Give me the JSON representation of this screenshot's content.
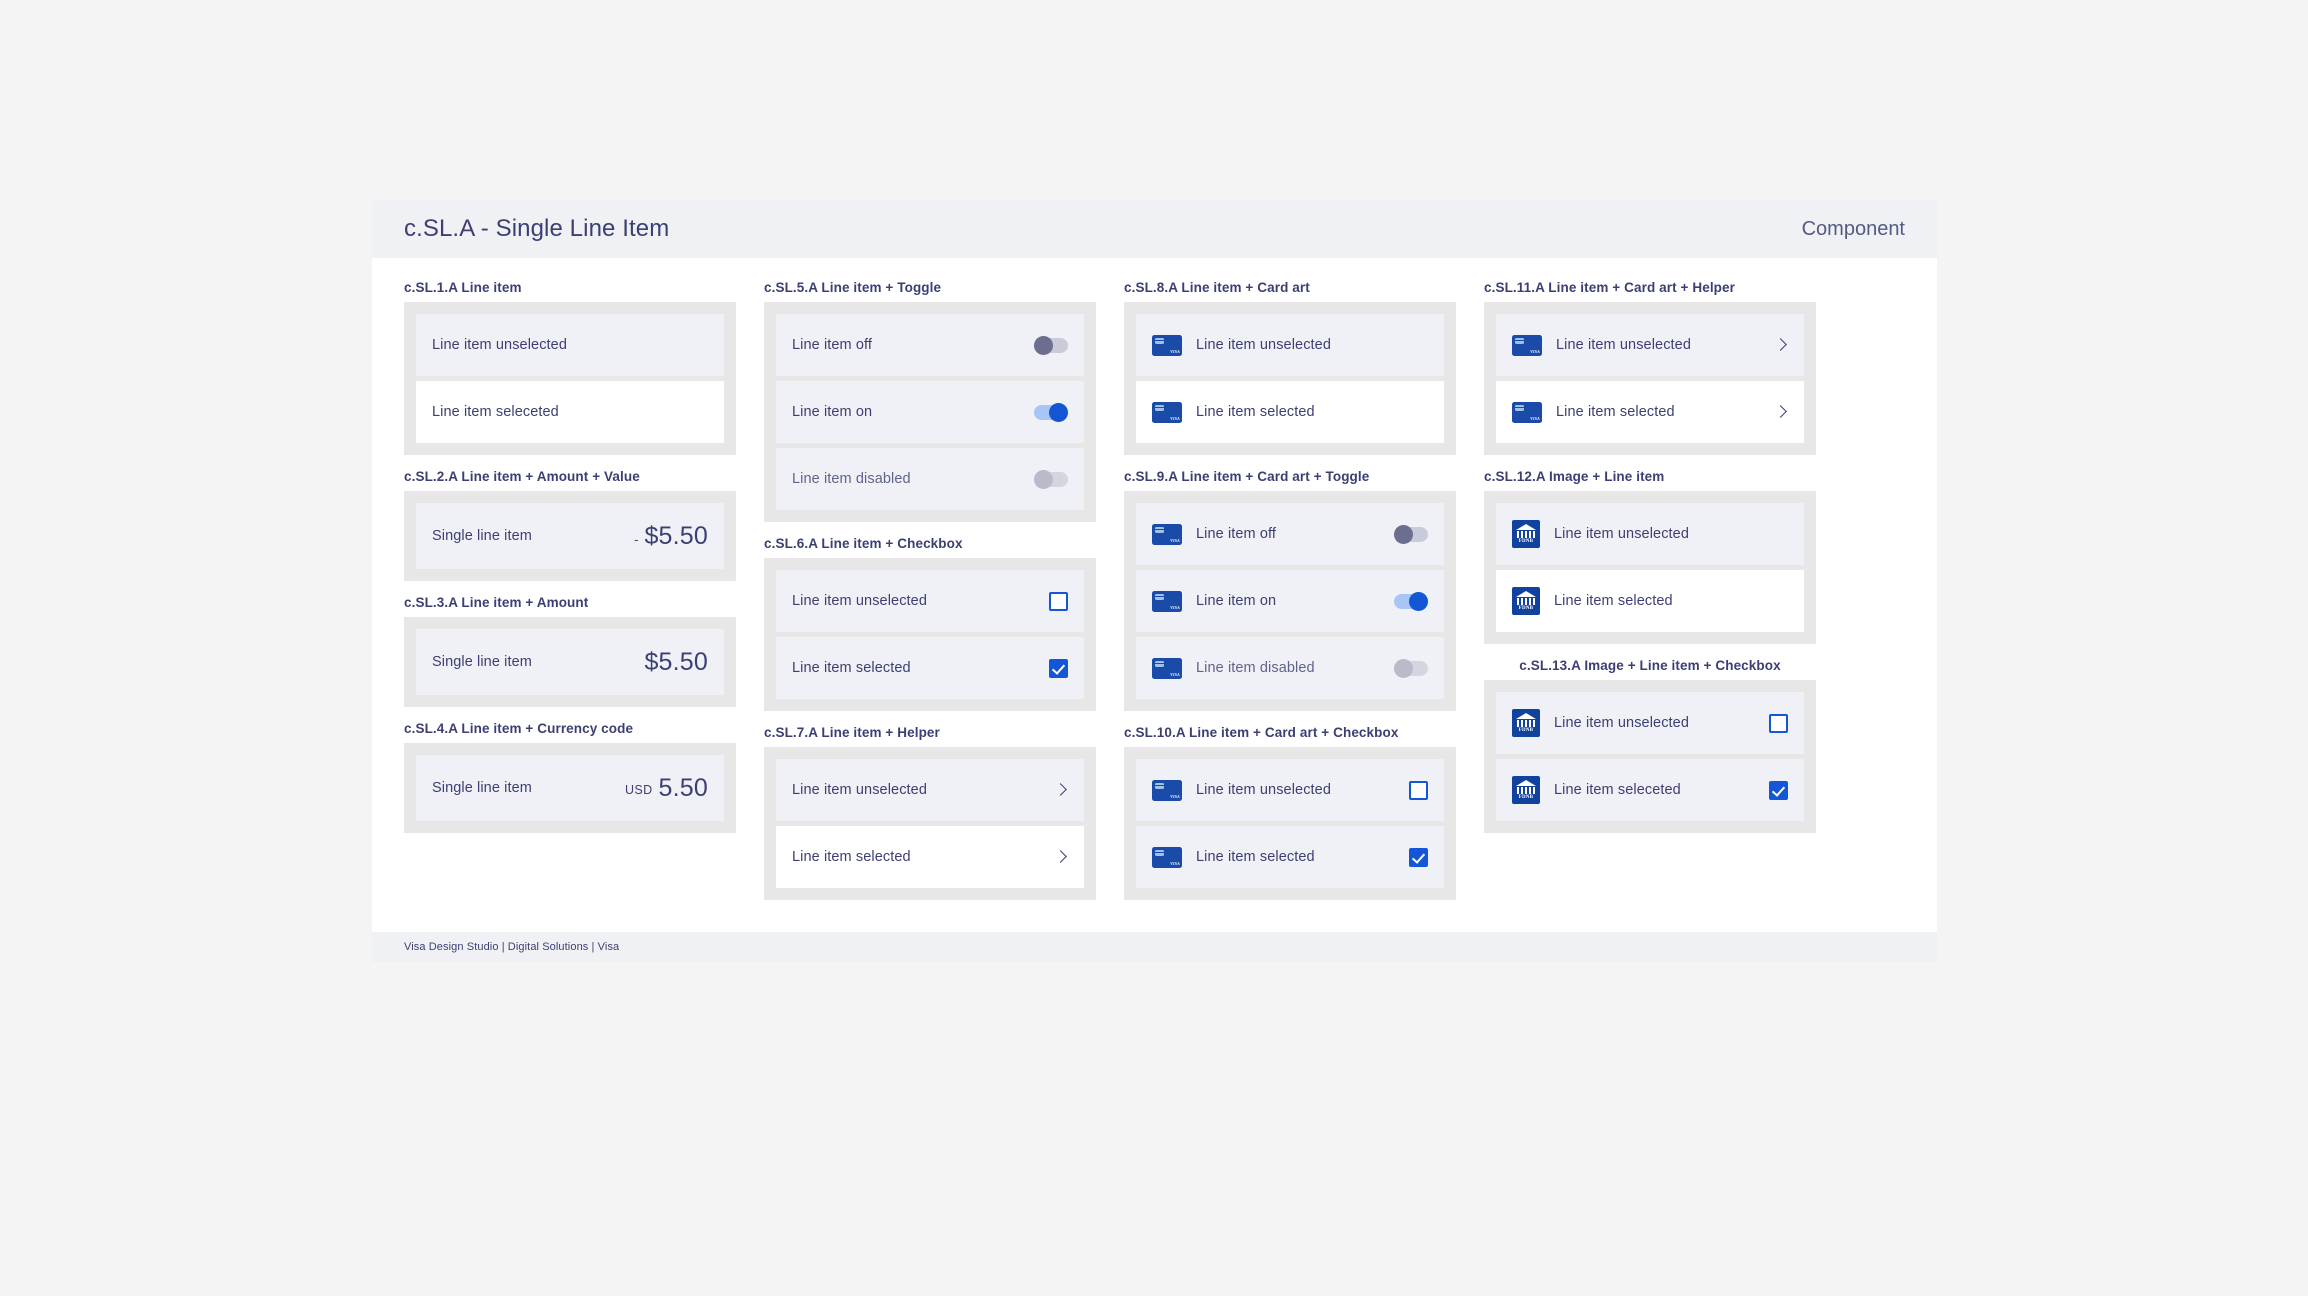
{
  "header": {
    "title": "c.SL.A - Single Line Item",
    "kind": "Component"
  },
  "footer": {
    "text": "Visa Design Studio | Digital Solutions | Visa"
  },
  "sections": {
    "sl1": {
      "label": "c.SL.1.A Line item",
      "rows": [
        {
          "label": "Line item unselected"
        },
        {
          "label": "Line item seleceted"
        }
      ]
    },
    "sl2": {
      "label": "c.SL.2.A Line item + Amount + Value",
      "rows": [
        {
          "label": "Single line item",
          "prefix": "-",
          "value": "$5.50"
        }
      ]
    },
    "sl3": {
      "label": "c.SL.3.A Line item + Amount",
      "rows": [
        {
          "label": "Single line item",
          "value": "$5.50"
        }
      ]
    },
    "sl4": {
      "label": "c.SL.4.A Line item + Currency code",
      "rows": [
        {
          "label": "Single line item",
          "code": "USD",
          "value": "5.50"
        }
      ]
    },
    "sl5": {
      "label": "c.SL.5.A Line item + Toggle",
      "rows": [
        {
          "label": "Line item off",
          "state": "off"
        },
        {
          "label": "Line item on",
          "state": "on"
        },
        {
          "label": "Line item disabled",
          "state": "disabled"
        }
      ]
    },
    "sl6": {
      "label": "c.SL.6.A Line item + Checkbox",
      "rows": [
        {
          "label": "Line item unselected",
          "state": "unchecked"
        },
        {
          "label": "Line item selected",
          "state": "checked"
        }
      ]
    },
    "sl7": {
      "label": "c.SL.7.A Line item + Helper",
      "rows": [
        {
          "label": "Line item unselected"
        },
        {
          "label": "Line item selected"
        }
      ]
    },
    "sl8": {
      "label": "c.SL.8.A Line item + Card art",
      "rows": [
        {
          "label": "Line item unselected"
        },
        {
          "label": "Line item selected"
        }
      ]
    },
    "sl9": {
      "label": "c.SL.9.A Line item + Card art + Toggle",
      "rows": [
        {
          "label": "Line item off",
          "state": "off"
        },
        {
          "label": "Line item on",
          "state": "on"
        },
        {
          "label": "Line item disabled",
          "state": "disabled"
        }
      ]
    },
    "sl10": {
      "label": "c.SL.10.A Line item + Card art + Checkbox",
      "rows": [
        {
          "label": "Line item unselected",
          "state": "unchecked"
        },
        {
          "label": "Line item selected",
          "state": "checked"
        }
      ]
    },
    "sl11": {
      "label": "c.SL.11.A Line item + Card art + Helper",
      "rows": [
        {
          "label": "Line item unselected"
        },
        {
          "label": "Line item selected"
        }
      ]
    },
    "sl12": {
      "label": "c.SL.12.A Image + Line item",
      "rows": [
        {
          "label": "Line item unselected"
        },
        {
          "label": "Line item selected"
        }
      ]
    },
    "sl13": {
      "label": "c.SL.13.A Image + Line item + Checkbox",
      "rows": [
        {
          "label": "Line item unselected",
          "state": "unchecked"
        },
        {
          "label": "Line item seleceted",
          "state": "checked"
        }
      ]
    }
  },
  "icons": {
    "card_art_brand": "VISA",
    "bank_image_name": "FDNB",
    "chevron": "chevron-right-icon"
  },
  "colors": {
    "brand_blue": "#1456d8",
    "card_blue": "#1a4ba8",
    "text_indigo": "#3b3f73",
    "panel_gray": "#e7e7e7",
    "row_unselected": "#f0f1f7",
    "page_bg": "#f4f4f4"
  }
}
